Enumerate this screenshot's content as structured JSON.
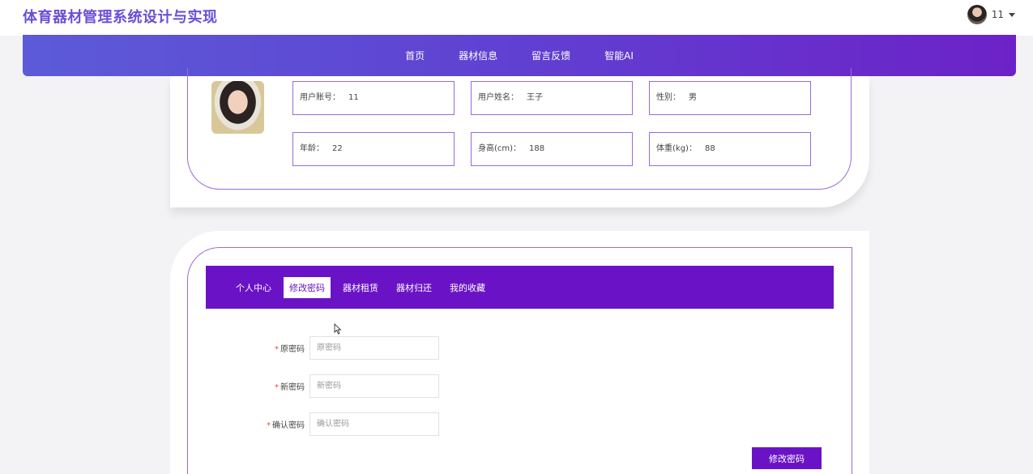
{
  "header": {
    "title": "体育器材管理系统设计与实现",
    "username": "11"
  },
  "nav": {
    "items": [
      "首页",
      "器材信息",
      "留言反馈",
      "智能AI"
    ]
  },
  "profile": {
    "fields": [
      {
        "label": "用户账号：",
        "value": "11"
      },
      {
        "label": "用户姓名：",
        "value": "王子"
      },
      {
        "label": "性别：",
        "value": "男"
      },
      {
        "label": "年龄：",
        "value": "22"
      },
      {
        "label": "身高(cm)：",
        "value": "188"
      },
      {
        "label": "体重(kg)：",
        "value": "88"
      }
    ]
  },
  "tabs": {
    "items": [
      "个人中心",
      "修改密码",
      "器材租赁",
      "器材归还",
      "我的收藏"
    ],
    "active": "修改密码"
  },
  "password_form": {
    "required_mark": "*",
    "fields": [
      {
        "label": "原密码",
        "placeholder": "原密码"
      },
      {
        "label": "新密码",
        "placeholder": "新密码"
      },
      {
        "label": "确认密码",
        "placeholder": "确认密码"
      }
    ],
    "submit_label": "修改密码"
  }
}
